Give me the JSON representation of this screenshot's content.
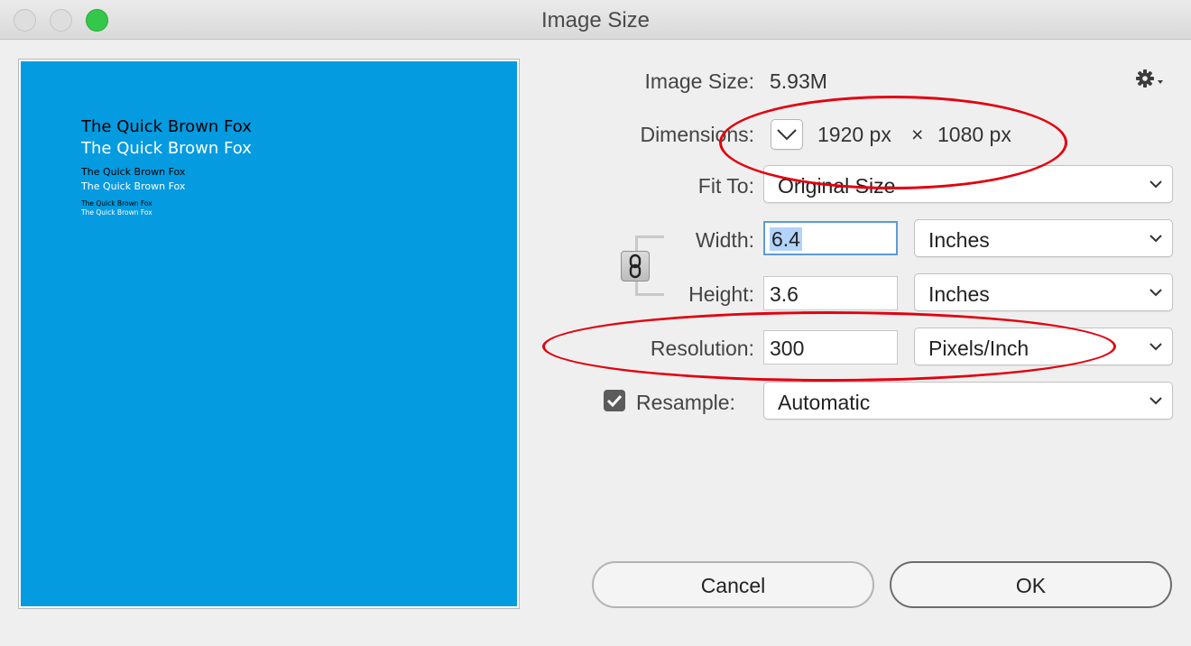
{
  "window": {
    "title": "Image Size"
  },
  "preview": {
    "lines": [
      {
        "text": "The Quick Brown Fox",
        "color": "#000000"
      },
      {
        "text": "The Quick Brown Fox",
        "color": "#ffffff"
      },
      {
        "text": "The Quick Brown Fox",
        "color": "#000000"
      },
      {
        "text": "The Quick Brown Fox",
        "color": "#ffffff"
      },
      {
        "text": "The Quick Brown Fox",
        "color": "#000000"
      },
      {
        "text": "The Quick Brown Fox",
        "color": "#ffffff"
      }
    ],
    "background_color": "#049be1"
  },
  "image_size": {
    "label": "Image Size:",
    "value": "5.93M"
  },
  "dimensions": {
    "label": "Dimensions:",
    "width": "1920 px",
    "separator": "×",
    "height": "1080 px"
  },
  "fit_to": {
    "label": "Fit To:",
    "value": "Original Size"
  },
  "width": {
    "label": "Width:",
    "value": "6.4",
    "unit": "Inches"
  },
  "height": {
    "label": "Height:",
    "value": "3.6",
    "unit": "Inches"
  },
  "resolution": {
    "label": "Resolution:",
    "value": "300",
    "unit": "Pixels/Inch"
  },
  "resample": {
    "label": "Resample:",
    "checked": true,
    "value": "Automatic"
  },
  "buttons": {
    "cancel": "Cancel",
    "ok": "OK"
  },
  "annotation_color": "#e3000f"
}
